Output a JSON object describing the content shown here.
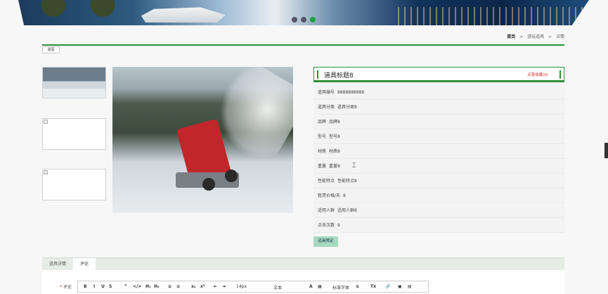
{
  "breadcrumb": {
    "home": "首页",
    "sep": ">",
    "section": "游玩道具",
    "current": "详情"
  },
  "back_label": "返回",
  "product": {
    "title": "道具标题8",
    "favorite": "点我收藏(0)",
    "fields": [
      {
        "label": "道具编号",
        "value": "8888888888"
      },
      {
        "label": "道具分类",
        "value": "道具分类8"
      },
      {
        "label": "品牌",
        "value": "品牌8"
      },
      {
        "label": "型号",
        "value": "型号8"
      },
      {
        "label": "材质",
        "value": "材质8"
      },
      {
        "label": "重量",
        "value": "重量8"
      },
      {
        "label": "性能特点",
        "value": "性能特点8"
      },
      {
        "label": "租赁价格/天",
        "value": "8"
      },
      {
        "label": "适用人群",
        "value": "适用人群8"
      },
      {
        "label": "点击次数",
        "value": "9"
      }
    ],
    "rent_button": "道具预定"
  },
  "tabs": [
    {
      "label": "道具详情"
    },
    {
      "label": "评论"
    }
  ],
  "editor": {
    "required_mark": "*",
    "label": "评论",
    "font_size": "14px",
    "text_style": "文本",
    "font_family": "标准字体",
    "buttons": [
      "B",
      "I",
      "U",
      "S",
      "❞",
      "</>",
      "H₁",
      "H₂",
      "≡",
      "≡",
      "x₂",
      "x²",
      "⇤",
      "⇥",
      "A",
      "▦",
      "≡",
      "Tx",
      "🔗",
      "▣",
      "▤"
    ]
  }
}
